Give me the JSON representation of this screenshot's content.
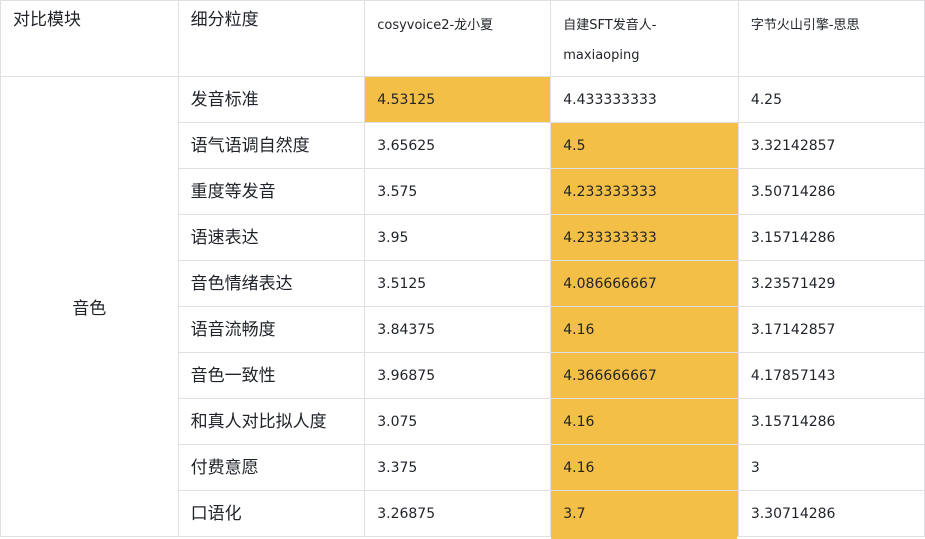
{
  "table": {
    "headers": {
      "module": "对比模块",
      "detail": "细分粒度",
      "col_a": "cosyvoice2-龙小夏",
      "col_b": "自建SFT发音人-maxiaoping",
      "col_c": "字节火山引擎-思思"
    },
    "group_label": "音色",
    "highlight_color": "#f4bf47",
    "rows": [
      {
        "metric": "发音标准",
        "a": "4.53125",
        "b": "4.433333333",
        "c": "4.25",
        "best": "a"
      },
      {
        "metric": "语气语调自然度",
        "a": "3.65625",
        "b": "4.5",
        "c": "3.32142857",
        "best": "b"
      },
      {
        "metric": "重度等发音",
        "a": "3.575",
        "b": "4.233333333",
        "c": "3.50714286",
        "best": "b"
      },
      {
        "metric": "语速表达",
        "a": "3.95",
        "b": "4.233333333",
        "c": "3.15714286",
        "best": "b"
      },
      {
        "metric": "音色情绪表达",
        "a": "3.5125",
        "b": "4.086666667",
        "c": "3.23571429",
        "best": "b"
      },
      {
        "metric": "语音流畅度",
        "a": "3.84375",
        "b": "4.16",
        "c": "3.17142857",
        "best": "b"
      },
      {
        "metric": "音色一致性",
        "a": "3.96875",
        "b": "4.366666667",
        "c": "4.17857143",
        "best": "b"
      },
      {
        "metric": "和真人对比拟人度",
        "a": "3.075",
        "b": "4.16",
        "c": "3.15714286",
        "best": "b"
      },
      {
        "metric": "付费意愿",
        "a": "3.375",
        "b": "4.16",
        "c": "3",
        "best": "b"
      },
      {
        "metric": "口语化",
        "a": "3.26875",
        "b": "3.7",
        "c": "3.30714286",
        "best": "b"
      }
    ]
  }
}
